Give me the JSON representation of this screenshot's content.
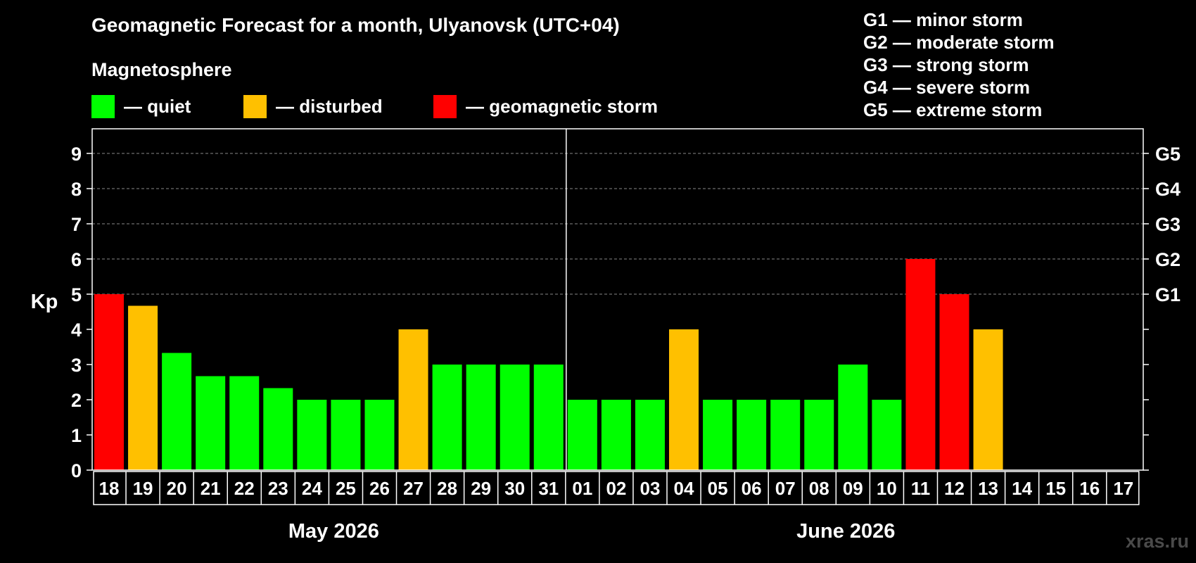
{
  "title": "Geomagnetic Forecast for a month, Ulyanovsk (UTC+04)",
  "magnetosphere_label": "Magnetosphere",
  "legend": [
    {
      "label": "— quiet",
      "color": "#00ff00"
    },
    {
      "label": "— disturbed",
      "color": "#ffc000"
    },
    {
      "label": "— geomagnetic storm",
      "color": "#ff0000"
    }
  ],
  "storm_legend": [
    "G1 — minor storm",
    "G2 — moderate storm",
    "G3 — strong storm",
    "G4 — severe storm",
    "G5 — extreme storm"
  ],
  "watermark": "xras.ru",
  "colors": {
    "quiet": "#00ff00",
    "disturbed": "#ffc000",
    "storm": "#ff0000",
    "background": "#000000",
    "grid": "#888888"
  },
  "chart_data": {
    "type": "bar",
    "ylabel": "Kp",
    "ylim": [
      0,
      9
    ],
    "yticks": [
      "0",
      "1",
      "2",
      "3",
      "4",
      "5",
      "6",
      "7",
      "8",
      "9"
    ],
    "right_ticks": [
      {
        "value": 5,
        "label": "G1"
      },
      {
        "value": 6,
        "label": "G2"
      },
      {
        "value": 7,
        "label": "G3"
      },
      {
        "value": 8,
        "label": "G4"
      },
      {
        "value": 9,
        "label": "G5"
      }
    ],
    "grid": "dashed horizontal lines at Kp 5-9",
    "categories": [
      "18",
      "19",
      "20",
      "21",
      "22",
      "23",
      "24",
      "25",
      "26",
      "27",
      "28",
      "29",
      "30",
      "31",
      "01",
      "02",
      "03",
      "04",
      "05",
      "06",
      "07",
      "08",
      "09",
      "10",
      "11",
      "12",
      "13",
      "14",
      "15",
      "16",
      "17"
    ],
    "values": [
      5,
      4.67,
      3.33,
      2.67,
      2.67,
      2.33,
      2,
      2,
      2,
      4,
      3,
      3,
      3,
      3,
      2,
      2,
      2,
      4,
      2,
      2,
      2,
      2,
      3,
      2,
      6,
      5,
      4,
      null,
      null,
      null,
      null
    ],
    "status": [
      "storm",
      "disturbed",
      "quiet",
      "quiet",
      "quiet",
      "quiet",
      "quiet",
      "quiet",
      "quiet",
      "disturbed",
      "quiet",
      "quiet",
      "quiet",
      "quiet",
      "quiet",
      "quiet",
      "quiet",
      "disturbed",
      "quiet",
      "quiet",
      "quiet",
      "quiet",
      "quiet",
      "quiet",
      "storm",
      "storm",
      "disturbed",
      null,
      null,
      null,
      null
    ],
    "months": [
      {
        "label": "May 2026",
        "first_index": 0,
        "last_index": 13
      },
      {
        "label": "June 2026",
        "first_index": 14,
        "last_index": 30
      }
    ]
  }
}
